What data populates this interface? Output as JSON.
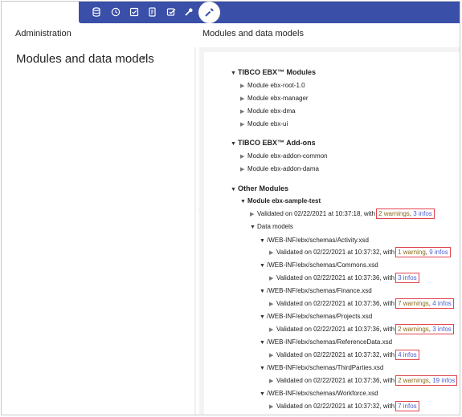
{
  "toolbar": {
    "icons": [
      "database-icon",
      "clock-icon",
      "checklist-icon",
      "document-edit-icon",
      "checkbox-icon",
      "tools-icon",
      "administration-icon"
    ]
  },
  "left": {
    "header": "Administration",
    "title": "Modules and data models"
  },
  "right": {
    "header": "Modules and data models"
  },
  "tree": {
    "tibco_modules": {
      "label": "TIBCO EBX™ Modules",
      "items": [
        "Module ebx-root-1.0",
        "Module ebx-manager",
        "Module ebx-dma",
        "Module ebx-ui"
      ]
    },
    "tibco_addons": {
      "label": "TIBCO EBX™ Add-ons",
      "items": [
        "Module ebx-addon-common",
        "Module ebx-addon-dama"
      ]
    },
    "other": {
      "label": "Other Modules",
      "module": "Module ebx-sample-test",
      "module_validated": "Validated on 02/22/2021 at 10:37:18, with",
      "module_warn": "2 warnings",
      "module_sep": ",",
      "module_info": "3 infos",
      "data_models": "Data models",
      "schemas": [
        {
          "path": "/WEB-INF/ebx/schemas/Activity.xsd",
          "validated": "Validated on 02/22/2021 at 10:37:32, with",
          "warn": "1 warning",
          "sep": ",",
          "info": "9 infos"
        },
        {
          "path": "/WEB-INF/ebx/schemas/Commons.xsd",
          "validated": "Validated on 02/22/2021 at 10:37:36, with",
          "warn": "",
          "sep": "",
          "info": "3 infos"
        },
        {
          "path": "/WEB-INF/ebx/schemas/Finance.xsd",
          "validated": "Validated on 02/22/2021 at 10:37:36, with",
          "warn": "7 warnings",
          "sep": ",",
          "info": "4 infos"
        },
        {
          "path": "/WEB-INF/ebx/schemas/Projects.xsd",
          "validated": "Validated on 02/22/2021 at 10:37:36, with",
          "warn": "2 warnings",
          "sep": ",",
          "info": "3 infos"
        },
        {
          "path": "/WEB-INF/ebx/schemas/ReferenceData.xsd",
          "validated": "Validated on 02/22/2021 at 10:37:32, with",
          "warn": "",
          "sep": "",
          "info": "4 infos"
        },
        {
          "path": "/WEB-INF/ebx/schemas/ThirdParties.xsd",
          "validated": "Validated on 02/22/2021 at 10:37:36, with",
          "warn": "2 warnings",
          "sep": ",",
          "info": "19 infos"
        },
        {
          "path": "/WEB-INF/ebx/schemas/Workforce.xsd",
          "validated": "Validated on 02/22/2021 at 10:37:32, with",
          "warn": "",
          "sep": "",
          "info": "7 infos"
        }
      ]
    }
  }
}
